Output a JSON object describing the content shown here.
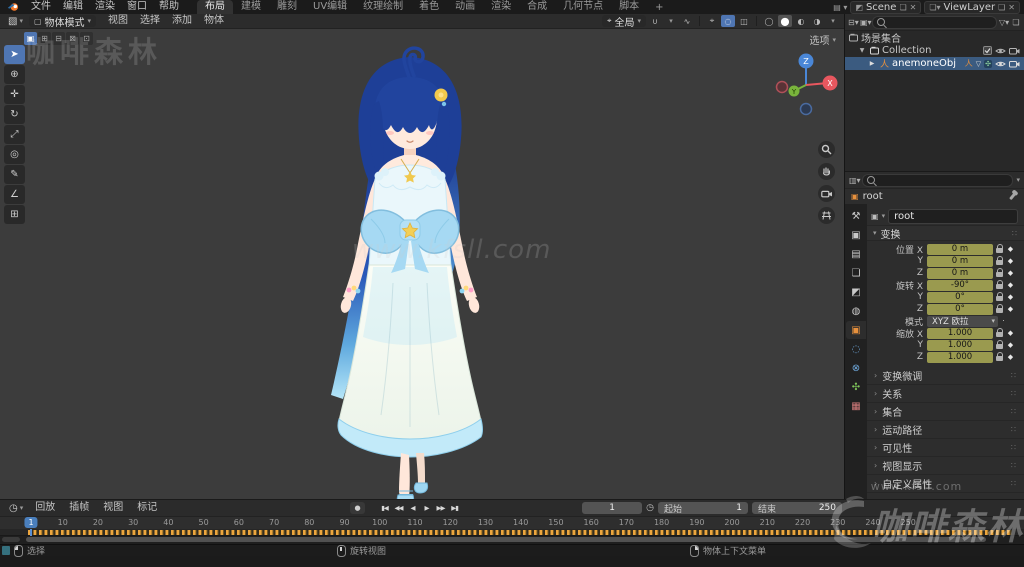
{
  "topbar": {
    "menus": [
      "文件",
      "编辑",
      "渲染",
      "窗口",
      "帮助"
    ],
    "workspaces": [
      "布局",
      "建模",
      "雕刻",
      "UV编辑",
      "纹理绘制",
      "着色",
      "动画",
      "渲染",
      "合成",
      "几何节点",
      "脚本"
    ],
    "active_workspace": "布局",
    "add_workspace_label": "+",
    "scene_label": "Scene",
    "view_layer_label": "ViewLayer"
  },
  "viewport": {
    "header": {
      "mode": "物体模式",
      "menus": [
        "视图",
        "选择",
        "添加",
        "物体"
      ],
      "orientation": "全局"
    },
    "tool_options_label": "选项",
    "select_modes": [
      {
        "name": "select-mode-new",
        "glyph": "▣",
        "active": true
      },
      {
        "name": "select-mode-extend",
        "glyph": "⊞"
      },
      {
        "name": "select-mode-subtract",
        "glyph": "⊟"
      },
      {
        "name": "select-mode-invert",
        "glyph": "⊠"
      },
      {
        "name": "select-mode-intersect",
        "glyph": "⊡"
      }
    ],
    "tools": [
      {
        "name": "tool-select-box",
        "glyph": "➤",
        "active": true
      },
      {
        "name": "tool-cursor",
        "glyph": "⊕"
      },
      {
        "name": "tool-move",
        "glyph": "✛"
      },
      {
        "name": "tool-rotate",
        "glyph": "↻"
      },
      {
        "name": "tool-scale",
        "glyph": "⤢"
      },
      {
        "name": "tool-transform",
        "glyph": "◎"
      },
      {
        "name": "tool-annotate",
        "glyph": "✎"
      },
      {
        "name": "tool-measure",
        "glyph": "∠"
      },
      {
        "name": "tool-add-cube",
        "glyph": "⊞"
      }
    ],
    "gizmo": {
      "x": "X",
      "y": "Y",
      "z": "Z"
    }
  },
  "outliner": {
    "rows": [
      {
        "label": "场景集合"
      },
      {
        "label": "Collection"
      },
      {
        "label": "anemoneObj"
      }
    ]
  },
  "properties": {
    "breadcrumb": "root",
    "name_value": "root",
    "tabs": [
      {
        "name": "tab-tool",
        "glyph": "⚒",
        "color": "#c9c9c9"
      },
      {
        "name": "tab-render",
        "glyph": "▣",
        "color": "#c9c9c9"
      },
      {
        "name": "tab-output",
        "glyph": "▤",
        "color": "#c9c9c9"
      },
      {
        "name": "tab-view-layer",
        "glyph": "❏",
        "color": "#c9c9c9"
      },
      {
        "name": "tab-scene",
        "glyph": "◩",
        "color": "#c9c9c9"
      },
      {
        "name": "tab-world",
        "glyph": "◍",
        "color": "#c9c9c9"
      },
      {
        "name": "tab-object",
        "glyph": "▣",
        "color": "#e8913d",
        "active": true
      },
      {
        "name": "tab-physics",
        "glyph": "◌",
        "color": "#6fa8dc"
      },
      {
        "name": "tab-constraints",
        "glyph": "⊗",
        "color": "#6fa8dc"
      },
      {
        "name": "tab-data",
        "glyph": "✣",
        "color": "#7ec45a"
      },
      {
        "name": "tab-texture",
        "glyph": "▦",
        "color": "#d47c7c"
      }
    ],
    "transform": {
      "title": "变换",
      "rows": [
        {
          "label": "位置 X",
          "value": "0 m"
        },
        {
          "label": "Y",
          "value": "0 m"
        },
        {
          "label": "Z",
          "value": "0 m"
        },
        {
          "label": "旋转 X",
          "value": "-90°"
        },
        {
          "label": "Y",
          "value": "0°"
        },
        {
          "label": "Z",
          "value": "0°"
        },
        {
          "label": "模式",
          "value": "XYZ 欧拉",
          "dropdown": true
        },
        {
          "label": "缩放 X",
          "value": "1.000"
        },
        {
          "label": "Y",
          "value": "1.000"
        },
        {
          "label": "Z",
          "value": "1.000"
        }
      ]
    },
    "panels": [
      "变换微调",
      "关系",
      "集合",
      "运动路径",
      "可见性",
      "视图显示",
      "自定义属性"
    ]
  },
  "timeline": {
    "menus": [
      "回放",
      "插帧",
      "视图",
      "标记"
    ],
    "transport": [
      {
        "name": "jump-to-start",
        "glyph": "▮◀"
      },
      {
        "name": "previous-keyframe",
        "glyph": "◀◀"
      },
      {
        "name": "play-reverse",
        "glyph": "◀"
      },
      {
        "name": "play",
        "glyph": "▶"
      },
      {
        "name": "next-keyframe",
        "glyph": "▶▶"
      },
      {
        "name": "jump-to-end",
        "glyph": "▶▮"
      }
    ],
    "current_frame": "1",
    "start_label": "起始",
    "start_value": "1",
    "end_label": "结束",
    "end_value": "250",
    "ticks": [
      1,
      10,
      20,
      30,
      40,
      50,
      60,
      70,
      80,
      90,
      100,
      110,
      120,
      130,
      140,
      150,
      160,
      170,
      180,
      190,
      200,
      210,
      220,
      230,
      240,
      250
    ]
  },
  "statusbar": {
    "hints": [
      {
        "button": "left",
        "label": "选择"
      },
      {
        "button": "middle",
        "label": "旋转视图"
      },
      {
        "button": "right",
        "label": "物体上下文菜单"
      }
    ]
  },
  "watermarks": {
    "top_left": "咖啡森林",
    "center": "www.kfsll.com",
    "site": "www.kfsll.com",
    "logo_text": "咖啡森林"
  },
  "colors": {
    "accent_blue": "#4f76b3",
    "keyed_field": "#9a9a4f",
    "keyframe_orange": "#eda63e",
    "selection_blue": "#3b5b80",
    "axis_x": "#e8575f",
    "axis_y": "#79b43c",
    "axis_z": "#4a87d7"
  }
}
